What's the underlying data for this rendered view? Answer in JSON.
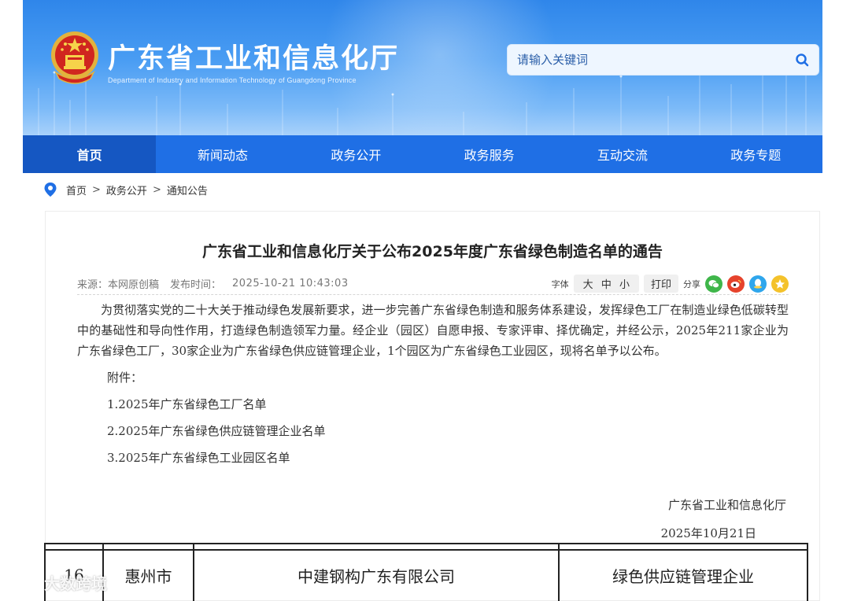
{
  "header": {
    "site_title": "广东省工业和信息化厅",
    "site_subtitle": "Department of Industry and Information Technology of Guangdong Province",
    "search_placeholder": "请输入关键词"
  },
  "nav": {
    "items": [
      {
        "label": "首页",
        "active": true
      },
      {
        "label": "新闻动态",
        "active": false
      },
      {
        "label": "政务公开",
        "active": false
      },
      {
        "label": "政务服务",
        "active": false
      },
      {
        "label": "互动交流",
        "active": false
      },
      {
        "label": "政务专题",
        "active": false
      }
    ]
  },
  "breadcrumb": {
    "items": [
      "首页",
      "政务公开",
      "通知公告"
    ],
    "separator": ">"
  },
  "article": {
    "title": "广东省工业和信息化厅关于公布2025年度广东省绿色制造名单的通告",
    "source_label": "来源：本网原创稿",
    "time_label": "发布时间：",
    "time": "2025-10-21 10:43:03",
    "font_label": "字体",
    "font_sizes": [
      "大",
      "中",
      "小"
    ],
    "print_label": "打印",
    "share_label": "分享",
    "share_icons": [
      "wechat-icon",
      "weibo-icon",
      "qq-icon",
      "qzone-icon"
    ],
    "lead": "为贯彻落实党的二十大关于推动绿色发展新要求，进一步完善广东省绿色制造和服务体系建设，发挥绿色工厂在制造业绿色低碳转型中的基础性和导向性作用，打造绿色制造领军力量。经企业（园区）自愿申报、专家评审、择优确定，并经公示，2025年211家企业为广东省绿色工厂，30家企业为广东省绿色供应链管理企业，1个园区为广东省绿色工业园区，现将名单予以公布。",
    "attachment_label": "附件：",
    "attachments": [
      "1.2025年广东省绿色工厂名单",
      "2.2025年广东省绿色供应链管理企业名单",
      "3.2025年广东省绿色工业园区名单"
    ],
    "signature_org": "广东省工业和信息化厅",
    "signature_date": "2025年10月21日"
  },
  "table_row": {
    "index": "16",
    "city": "惠州市",
    "company": "中建钢构广东有限公司",
    "category": "绿色供应链管理企业"
  },
  "watermark": "大数跨境",
  "colors": {
    "nav_bg": "#1f6fe5",
    "nav_active": "#1557c2",
    "header_top": "#2f86ea",
    "breadcrumb_pin": "#1f6fe5"
  }
}
